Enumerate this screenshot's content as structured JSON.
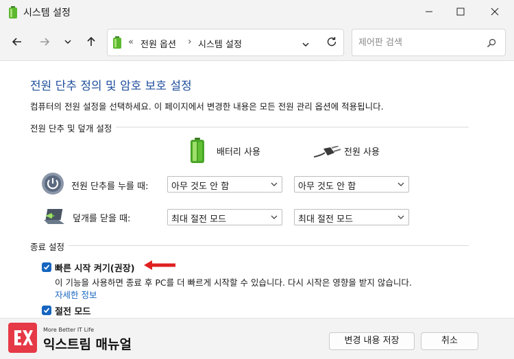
{
  "window": {
    "title": "시스템 설정"
  },
  "nav": {
    "breadcrumb_sep": "«",
    "breadcrumb": [
      "전원 옵션",
      "시스템 설정"
    ],
    "breadcrumb_arrow": "›",
    "search_placeholder": "제어판 검색"
  },
  "page": {
    "heading": "전원 단추 정의 및 암호 보호 설정",
    "description": "컴퓨터의 전원 설정을 선택하세요. 이 페이지에서 변경한 내용은 모든 전원 관리 옵션에 적용됩니다."
  },
  "power_section": {
    "label": "전원 단추 및 덮개 설정",
    "col_battery": "배터리 사용",
    "col_plugged": "전원 사용",
    "rows": [
      {
        "label": "전원 단추를 누를 때:",
        "battery": "아무 것도 안 함",
        "plugged": "아무 것도 안 함",
        "icon": "power-button-icon"
      },
      {
        "label": "덮개를 닫을 때:",
        "battery": "최대 절전 모드",
        "plugged": "최대 절전 모드",
        "icon": "laptop-lid-icon"
      }
    ]
  },
  "shutdown_section": {
    "label": "종료 설정",
    "items": [
      {
        "label": "빠른 시작 켜기(권장)",
        "checked": true,
        "description": "이 기능을 사용하면 종료 후 PC를 더 빠르게 시작할 수 있습니다. 다시 시작은 영향을 받지 않습니다.",
        "link": "자세한 정보"
      },
      {
        "label": "절전 모드",
        "checked": true
      }
    ]
  },
  "footer": {
    "brand_tag": "More Better IT Life",
    "brand_name": "익스트림 매뉴얼",
    "save_label": "변경 내용 저장",
    "cancel_label": "취소"
  },
  "colors": {
    "accent": "#1565c0",
    "heading": "#1f4e9c",
    "arrow": "#e02020",
    "logo": "#e63946"
  }
}
